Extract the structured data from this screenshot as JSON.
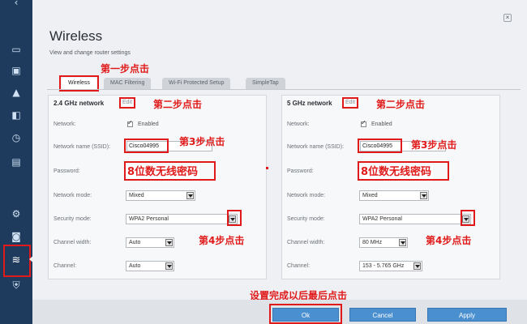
{
  "rail": {
    "icons": [
      "back-chevron-icon",
      "router-icon",
      "briefcase-icon",
      "warning-icon",
      "devices-icon",
      "clock-icon",
      "network-map-icon",
      "gear-icon",
      "camera-icon",
      "wifi-icon",
      "shield-icon"
    ]
  },
  "panel": {
    "title": "Wireless",
    "subtitle": "View and change router settings",
    "close_label": "×"
  },
  "tabs": [
    {
      "label": "Wireless"
    },
    {
      "label": "MAC Filtering"
    },
    {
      "label": "Wi-Fi Protected Setup"
    },
    {
      "label": "SimpleTap"
    }
  ],
  "band24": {
    "title": "2.4 GHz network",
    "edit": "Edit",
    "network_label": "Network:",
    "enabled_label": "Enabled",
    "ssid_label": "Network name (SSID):",
    "ssid_value": "Cisco04995",
    "password_label": "Password:",
    "mode_label": "Network mode:",
    "mode_value": "Mixed",
    "security_label": "Security mode:",
    "security_value": "WPA2 Personal",
    "width_label": "Channel width:",
    "width_value": "Auto",
    "channel_label": "Channel:",
    "channel_value": "Auto"
  },
  "band5": {
    "title": "5 GHz network",
    "edit": "Edit",
    "network_label": "Network:",
    "enabled_label": "Enabled",
    "ssid_label": "Network name (SSID):",
    "ssid_value": "Cisco04995",
    "password_label": "Password:",
    "mode_label": "Network mode:",
    "mode_value": "Mixed",
    "security_label": "Security mode:",
    "security_value": "WPA2 Personal",
    "width_label": "Channel width:",
    "width_value": "80 MHz",
    "channel_label": "Channel:",
    "channel_value": "153 - 5.765 GHz"
  },
  "annotations": {
    "step1": "第一步点击",
    "step2": "第二步点击",
    "step3": "第3步点击",
    "step4": "第4步点击",
    "password_hint": "8位数无线密码",
    "final": "设置完成以后最后点击"
  },
  "buttons": {
    "ok": "Ok",
    "cancel": "Cancel",
    "apply": "Apply"
  },
  "colors": {
    "annotation_red": "#e01a1a",
    "button_blue": "#4a8fd0",
    "rail_navy": "#1e3a5c"
  }
}
